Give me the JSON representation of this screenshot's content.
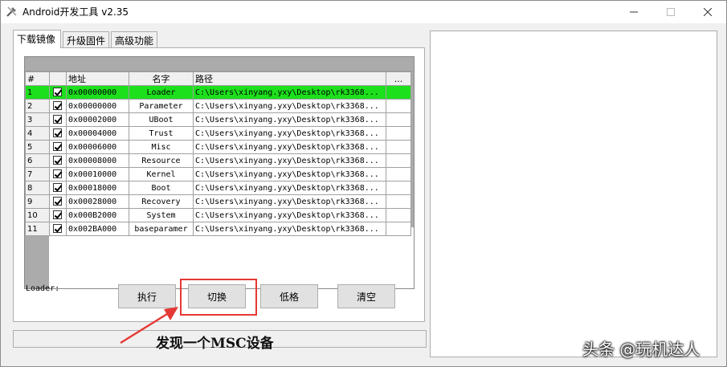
{
  "window": {
    "title": "Android开发工具 v2.35",
    "min_label": "—",
    "max_label": "☐",
    "close_label": "✕"
  },
  "tabs": [
    {
      "label": "下载镜像",
      "active": true
    },
    {
      "label": "升级固件",
      "active": false
    },
    {
      "label": "高级功能",
      "active": false
    }
  ],
  "grid": {
    "headers": {
      "num": "#",
      "check": "",
      "address": "地址",
      "name": "名字",
      "path": "路径",
      "more": "..."
    },
    "rows": [
      {
        "num": "1",
        "address": "0x00000000",
        "name": "Loader",
        "path": "C:\\Users\\xinyang.yxy\\Desktop\\rk3368...",
        "selected": true
      },
      {
        "num": "2",
        "address": "0x00000000",
        "name": "Parameter",
        "path": "C:\\Users\\xinyang.yxy\\Desktop\\rk3368..."
      },
      {
        "num": "3",
        "address": "0x00002000",
        "name": "UBoot",
        "path": "C:\\Users\\xinyang.yxy\\Desktop\\rk3368..."
      },
      {
        "num": "4",
        "address": "0x00004000",
        "name": "Trust",
        "path": "C:\\Users\\xinyang.yxy\\Desktop\\rk3368..."
      },
      {
        "num": "5",
        "address": "0x00006000",
        "name": "Misc",
        "path": "C:\\Users\\xinyang.yxy\\Desktop\\rk3368..."
      },
      {
        "num": "6",
        "address": "0x00008000",
        "name": "Resource",
        "path": "C:\\Users\\xinyang.yxy\\Desktop\\rk3368..."
      },
      {
        "num": "7",
        "address": "0x00010000",
        "name": "Kernel",
        "path": "C:\\Users\\xinyang.yxy\\Desktop\\rk3368..."
      },
      {
        "num": "8",
        "address": "0x00018000",
        "name": "Boot",
        "path": "C:\\Users\\xinyang.yxy\\Desktop\\rk3368..."
      },
      {
        "num": "9",
        "address": "0x00028000",
        "name": "Recovery",
        "path": "C:\\Users\\xinyang.yxy\\Desktop\\rk3368..."
      },
      {
        "num": "10",
        "address": "0x000B2000",
        "name": "System",
        "path": "C:\\Users\\xinyang.yxy\\Desktop\\rk3368..."
      },
      {
        "num": "11",
        "address": "0x002BA000",
        "name": "baseparamer",
        "path": "C:\\Users\\xinyang.yxy\\Desktop\\rk3368..."
      }
    ]
  },
  "controls": {
    "loader_label": "Loader:",
    "exec_label": "执行",
    "switch_label": "切换",
    "lowformat_label": "低格",
    "clear_label": "清空"
  },
  "annotation": {
    "text": "发现一个MSC设备",
    "color": "#e53935"
  },
  "watermark": "头条 @玩机达人",
  "colors": {
    "selected_row": "#1de01d",
    "highlight": "#e53935"
  }
}
